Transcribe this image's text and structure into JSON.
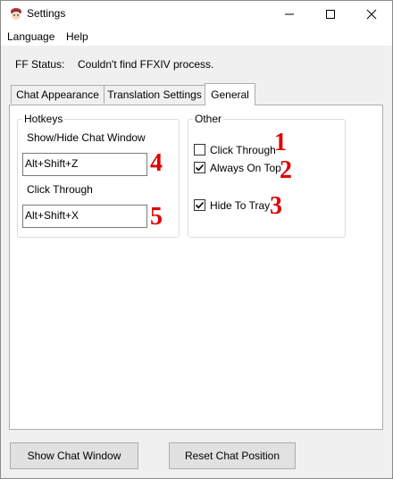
{
  "window": {
    "title": "Settings"
  },
  "menu": {
    "items": [
      "Language",
      "Help"
    ]
  },
  "status": {
    "label": "FF Status:",
    "value": "Couldn't find FFXIV process."
  },
  "tabs": [
    "Chat Appearance",
    "Translation Settings",
    "General"
  ],
  "active_tab": "General",
  "hotkeys": {
    "title": "Hotkeys",
    "show_hide_label": "Show/Hide Chat Window",
    "show_hide_value": "Alt+Shift+Z",
    "click_through_label": "Click Through",
    "click_through_value": "Alt+Shift+X"
  },
  "other": {
    "title": "Other",
    "click_through": {
      "label": "Click Through",
      "checked": false
    },
    "always_on_top": {
      "label": "Always On Top",
      "checked": true
    },
    "hide_to_tray": {
      "label": "Hide To Tray",
      "checked": true
    }
  },
  "annotations": [
    "1",
    "2",
    "3",
    "4",
    "5"
  ],
  "buttons": {
    "show_chat": "Show Chat Window",
    "reset_chat": "Reset Chat Position"
  },
  "colors": {
    "annotation": "#e00000",
    "window_bg": "#f0f0f0",
    "panel_bg": "#ffffff",
    "button_bg": "#e1e1e1"
  },
  "icons": {
    "app": "app-icon",
    "minimize": "minimize-icon",
    "maximize": "maximize-icon",
    "close": "close-icon",
    "check": "checkmark-icon"
  }
}
